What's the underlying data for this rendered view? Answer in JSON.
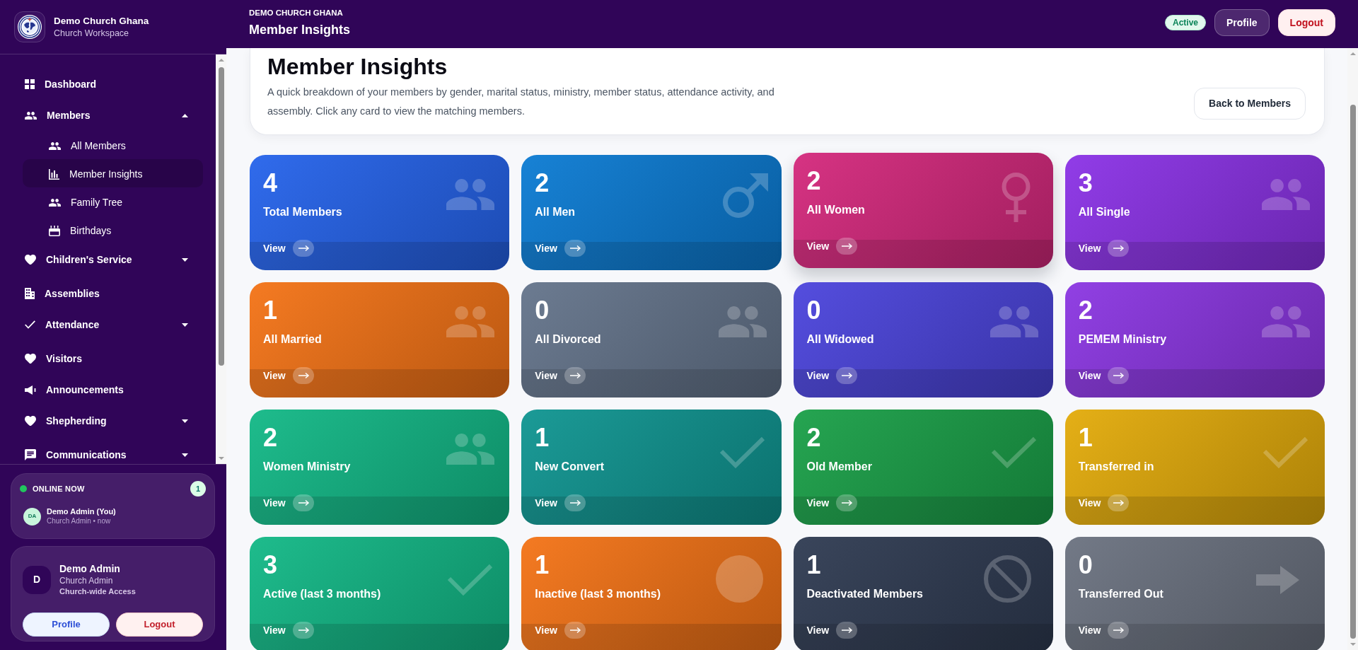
{
  "sidebar": {
    "brand": {
      "title": "Demo Church Ghana",
      "subtitle": "Church Workspace"
    },
    "nav": [
      {
        "label": "Dashboard",
        "kind": "dashboard",
        "selected": false
      },
      {
        "label": "Members",
        "kind": "members",
        "selected": false,
        "expanded": true,
        "children": [
          {
            "label": "All Members",
            "kind": "members",
            "selected": false
          },
          {
            "label": "Member Insights",
            "kind": "insights",
            "selected": true
          },
          {
            "label": "Family Tree",
            "kind": "family",
            "selected": false
          },
          {
            "label": "Birthdays",
            "kind": "birthdays",
            "selected": false
          }
        ]
      },
      {
        "label": "Children's Service",
        "kind": "children",
        "selected": false,
        "expanded": false
      },
      {
        "label": "Assemblies",
        "kind": "assemblies",
        "selected": false
      },
      {
        "label": "Attendance",
        "kind": "attendance",
        "selected": false,
        "expanded": false
      },
      {
        "label": "Visitors",
        "kind": "visitors",
        "selected": false
      },
      {
        "label": "Announcements",
        "kind": "announcements",
        "selected": false
      },
      {
        "label": "Shepherding",
        "kind": "shepherding",
        "selected": false,
        "expanded": false
      },
      {
        "label": "Communications",
        "kind": "communications",
        "selected": false,
        "expanded": false
      }
    ],
    "online": {
      "title": "ONLINE NOW",
      "count": "1",
      "users": [
        {
          "initials": "DA",
          "name": "Demo Admin (You)",
          "detail": "Church Admin • now"
        }
      ]
    },
    "user": {
      "initial": "D",
      "name": "Demo Admin",
      "role": "Church Admin",
      "access": "Church-wide Access",
      "buttons": [
        {
          "label": "Profile",
          "kind": "profile"
        },
        {
          "label": "Logout",
          "kind": "logout"
        }
      ]
    }
  },
  "topbar": {
    "eyebrow": "DEMO CHURCH GHANA",
    "title": "Member Insights",
    "status": "Active",
    "buttons": [
      {
        "label": "Profile",
        "kind": "profile"
      },
      {
        "label": "Logout",
        "kind": "logout"
      }
    ]
  },
  "page_header": {
    "title": "Member Insights",
    "description": "A quick breakdown of your members by gender, marital status, ministry, member status, attendance activity, and assembly. Click any card to view the matching members.",
    "button": "Back to Members"
  },
  "cards": [
    {
      "value": "4",
      "label": "Total Members",
      "action": "View",
      "kind": "group",
      "color": "#2563eb",
      "hovered": false
    },
    {
      "value": "2",
      "label": "All Men",
      "action": "View",
      "kind": "men",
      "color": "#0b7bd3",
      "hovered": false
    },
    {
      "value": "2",
      "label": "All Women",
      "action": "View",
      "kind": "women",
      "color": "#d4287c",
      "hovered": true
    },
    {
      "value": "3",
      "label": "All Single",
      "action": "View",
      "kind": "group",
      "color": "#8b32e6",
      "hovered": false
    },
    {
      "value": "1",
      "label": "All Married",
      "action": "View",
      "kind": "group",
      "color": "#f47316",
      "hovered": false
    },
    {
      "value": "0",
      "label": "All Divorced",
      "action": "View",
      "kind": "group",
      "color": "#64748b",
      "hovered": false
    },
    {
      "value": "0",
      "label": "All Widowed",
      "action": "View",
      "kind": "group",
      "color": "#4b44dc",
      "hovered": false
    },
    {
      "value": "2",
      "label": "PEMEM Ministry",
      "action": "View",
      "kind": "group",
      "color": "#8b36e2",
      "hovered": false
    },
    {
      "value": "2",
      "label": "Women Ministry",
      "action": "View",
      "kind": "group",
      "color": "#12b886",
      "hovered": false
    },
    {
      "value": "1",
      "label": "New Convert",
      "action": "View",
      "kind": "status",
      "color": "#0f9591",
      "hovered": false
    },
    {
      "value": "2",
      "label": "Old Member",
      "action": "View",
      "kind": "status",
      "color": "#1aa048",
      "hovered": false
    },
    {
      "value": "1",
      "label": "Transferred in",
      "action": "View",
      "kind": "status",
      "color": "#e3ab0a",
      "hovered": false
    },
    {
      "value": "3",
      "label": "Active (last 3 months)",
      "action": "View",
      "kind": "status",
      "color": "#12b886",
      "hovered": false
    },
    {
      "value": "1",
      "label": "Inactive (last 3 months)",
      "action": "View",
      "kind": "inactive",
      "color": "#f47316",
      "hovered": false
    },
    {
      "value": "1",
      "label": "Deactivated Members",
      "action": "View",
      "kind": "deactivated",
      "color": "#2f3b52",
      "hovered": false
    },
    {
      "value": "0",
      "label": "Transferred Out",
      "action": "View",
      "kind": "outbound",
      "color": "#6b7280",
      "hovered": false
    }
  ]
}
